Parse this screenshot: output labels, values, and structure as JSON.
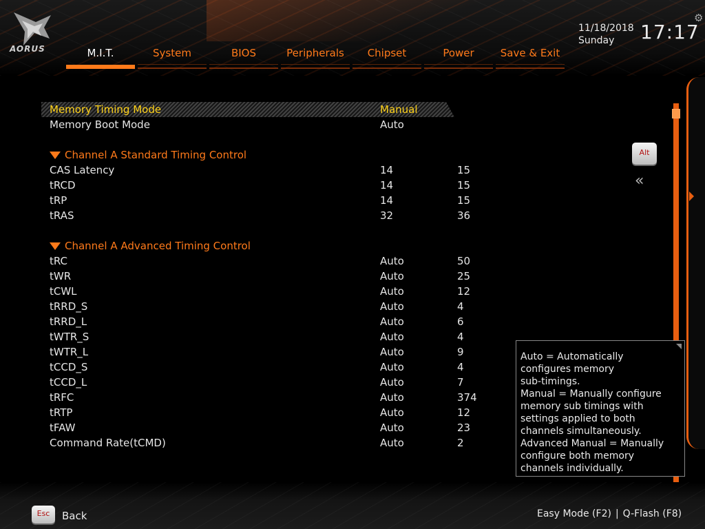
{
  "header": {
    "logo_text": "AORUS",
    "date": "11/18/2018",
    "day": "Sunday",
    "time": "17:17",
    "tabs": [
      {
        "label": "M.I.T.",
        "active": true
      },
      {
        "label": "System"
      },
      {
        "label": "BIOS"
      },
      {
        "label": "Peripherals"
      },
      {
        "label": "Chipset"
      },
      {
        "label": "Power"
      },
      {
        "label": "Save & Exit"
      }
    ]
  },
  "settings": {
    "memory_timing_mode": {
      "label": "Memory Timing Mode",
      "value": "Manual"
    },
    "memory_boot_mode": {
      "label": "Memory Boot Mode",
      "value": "Auto"
    },
    "standard_section": "Channel A Standard Timing Control",
    "standard": [
      {
        "label": "CAS Latency",
        "value": "14",
        "current": "15"
      },
      {
        "label": "tRCD",
        "value": "14",
        "current": "15"
      },
      {
        "label": "tRP",
        "value": "14",
        "current": "15"
      },
      {
        "label": "tRAS",
        "value": "32",
        "current": "36"
      }
    ],
    "advanced_section": "Channel A Advanced Timing Control",
    "advanced": [
      {
        "label": "tRC",
        "value": "Auto",
        "current": "50"
      },
      {
        "label": "tWR",
        "value": "Auto",
        "current": "25"
      },
      {
        "label": "tCWL",
        "value": "Auto",
        "current": "12"
      },
      {
        "label": "tRRD_S",
        "value": "Auto",
        "current": "4"
      },
      {
        "label": "tRRD_L",
        "value": "Auto",
        "current": "6"
      },
      {
        "label": "tWTR_S",
        "value": "Auto",
        "current": "4"
      },
      {
        "label": "tWTR_L",
        "value": "Auto",
        "current": "9"
      },
      {
        "label": "tCCD_S",
        "value": "Auto",
        "current": "4"
      },
      {
        "label": "tCCD_L",
        "value": "Auto",
        "current": "7"
      },
      {
        "label": "tRFC",
        "value": "Auto",
        "current": "374"
      },
      {
        "label": "tRTP",
        "value": "Auto",
        "current": "12"
      },
      {
        "label": "tFAW",
        "value": "Auto",
        "current": "23"
      },
      {
        "label": "Command Rate(tCMD)",
        "value": "Auto",
        "current": "2"
      }
    ]
  },
  "controls": {
    "alt_label": "Alt",
    "collapse_glyph": "«"
  },
  "help": {
    "text": "Auto = Automatically\nconfigures memory\nsub-timings.\nManual = Manually configure\nmemory sub timings with\nsettings applied to both\nchannels simultaneously.\nAdvanced Manual = Manually\nconfigure both memory\nchannels individually."
  },
  "footer": {
    "esc_label": "Esc",
    "back_label": "Back",
    "easy_mode": "Easy Mode (F2)",
    "separator": "|",
    "qflash": "Q-Flash (F8)"
  },
  "colors": {
    "accent": "#ff7a1a",
    "selected_text": "#ffd21a",
    "background": "#000000"
  },
  "icons": [
    "aorus-eagle-icon",
    "gear-icon",
    "alt-key-icon",
    "double-chevron-left-icon",
    "section-triangle-icon",
    "esc-key-icon"
  ]
}
